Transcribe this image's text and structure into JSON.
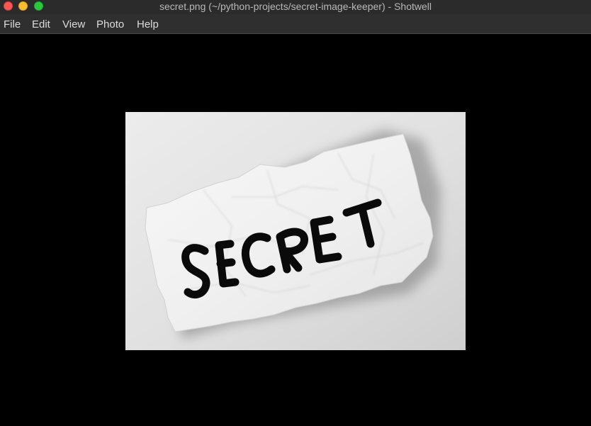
{
  "window": {
    "title": "secret.png (~/python-projects/secret-image-keeper) - Shotwell",
    "controls": [
      "close",
      "minimize",
      "maximize"
    ],
    "colors": {
      "close": "#fc5652",
      "minimize": "#fdbb2f",
      "maximize": "#2ac83f"
    }
  },
  "menubar": {
    "items": [
      {
        "label": "File"
      },
      {
        "label": "Edit"
      },
      {
        "label": "View"
      },
      {
        "label": "Photo"
      },
      {
        "label": "Help"
      }
    ]
  },
  "photo": {
    "word": "SECRET",
    "background": "#000000"
  }
}
